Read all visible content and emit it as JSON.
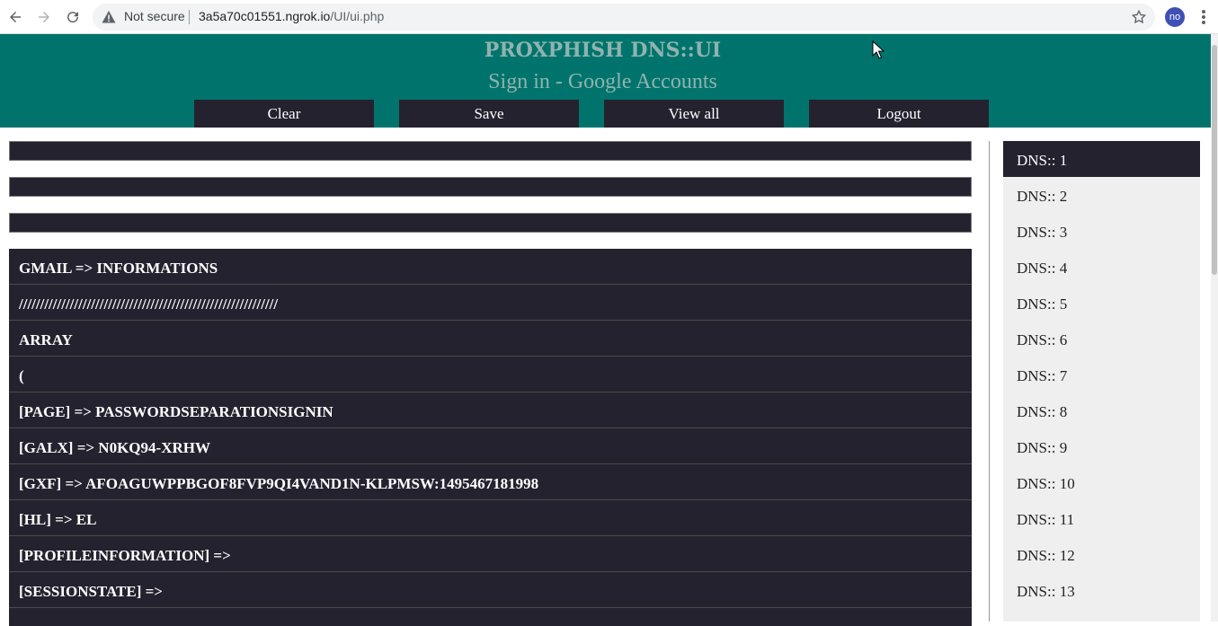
{
  "browser": {
    "security_label": "Not secure",
    "url_host": "3a5a70c01551.ngrok.io",
    "url_path": "/UI/ui.php",
    "profile_initials": "no"
  },
  "header": {
    "title": "PROXPHISH DNS::UI",
    "subtitle": "Sign in - Google Accounts",
    "buttons": {
      "clear": "Clear",
      "save": "Save",
      "view_all": "View all",
      "logout": "Logout"
    }
  },
  "results": {
    "rows": [
      "GMAIL => INFORMATIONS",
      "/////////////////////////////////////////////////////////////",
      "ARRAY",
      "(",
      "[PAGE] => PASSWORDSEPARATIONSIGNIN",
      "[GALX] => N0KQ94-XRHW",
      "[GXF] => AFOAGUWPPBGOF8FVP9QI4VAND1N-KLPMSW:1495467181998",
      "[HL] => EL",
      "[PROFILEINFORMATION] =>",
      "[SESSIONSTATE] =>"
    ]
  },
  "sidebar": {
    "items": [
      "DNS:: 1",
      "DNS:: 2",
      "DNS:: 3",
      "DNS:: 4",
      "DNS:: 5",
      "DNS:: 6",
      "DNS:: 7",
      "DNS:: 8",
      "DNS:: 9",
      "DNS:: 10",
      "DNS:: 11",
      "DNS:: 12",
      "DNS:: 13"
    ],
    "active_index": 0
  },
  "colors": {
    "header_bg": "#00746c",
    "dark_panel": "#25222f",
    "sidebar_bg": "#efefef"
  }
}
